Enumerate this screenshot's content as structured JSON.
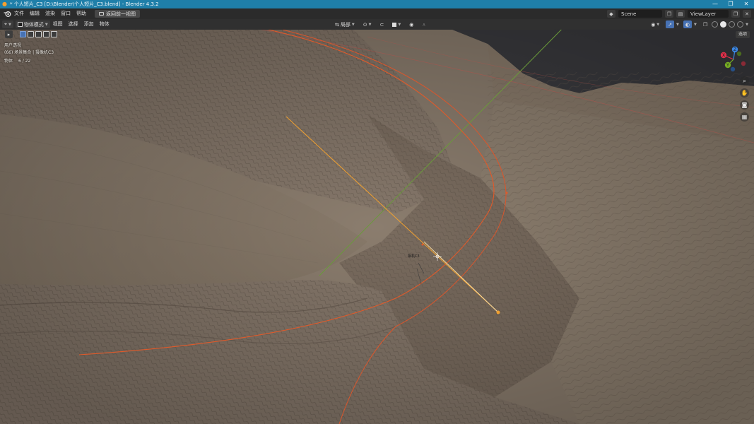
{
  "titlebar": {
    "title": "* 个人短片_C3 [D:\\Blender\\个人短片_C3.blend] - Blender 4.3.2",
    "minimize": "—",
    "maximize": "❐",
    "close": "✕"
  },
  "menu": {
    "items": [
      "文件",
      "编辑",
      "渲染",
      "窗口",
      "帮助"
    ],
    "workspace_tab": "返回前一视图"
  },
  "topbar_right": {
    "scene": "Scene",
    "view_layer": "ViewLayer"
  },
  "viewport_header": {
    "mode": "物体模式",
    "menus": [
      "视图",
      "选择",
      "添加",
      "物体"
    ],
    "transform_orientation": "局部",
    "options_label": "选项"
  },
  "overlay": {
    "view_name": "用户透视",
    "collection_info": "(66) 场景集合 | 摄像机C3",
    "stats_label": "物体",
    "stats_value": "6 / 22"
  },
  "gizmo": {
    "x_label": "X",
    "y_label": "Y",
    "z_label": "Z",
    "x_color": "#e0304a",
    "y_color": "#76ad24",
    "z_color": "#3b86e2"
  },
  "navigation": {
    "icons": [
      "zoom-icon",
      "hand-pan-icon",
      "camera-view-icon",
      "grid-ortho-icon"
    ]
  },
  "scene": {
    "camera_label": "相机C3",
    "colors": {
      "terrain": "#8a7c6d",
      "curve": "#e05a2a",
      "camera_line": "#f0a030",
      "axis_y": "#6a9a3a",
      "water": "#3c3c40"
    }
  }
}
